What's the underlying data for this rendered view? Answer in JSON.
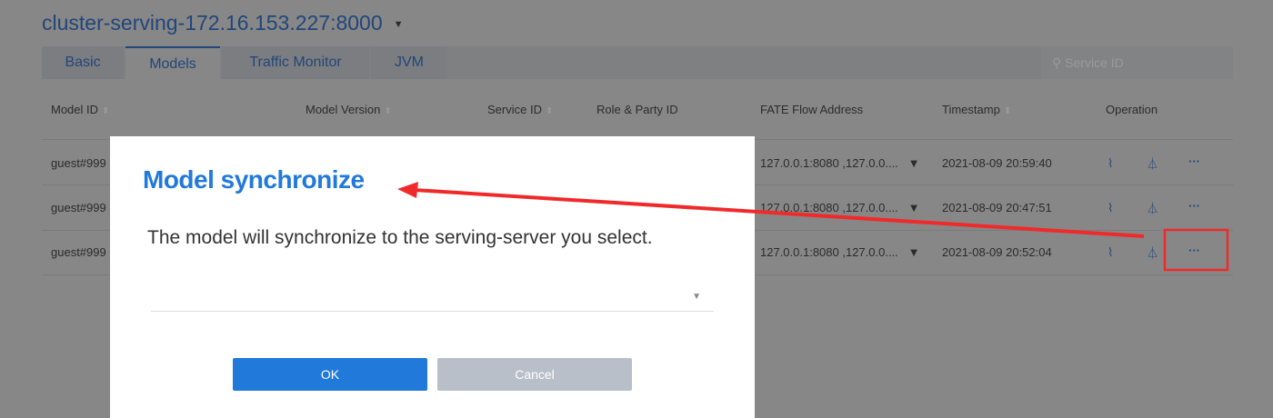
{
  "header": {
    "title": "cluster-serving-172.16.153.227:8000"
  },
  "tabs": [
    {
      "label": "Basic"
    },
    {
      "label": "Models"
    },
    {
      "label": "Traffic Monitor"
    },
    {
      "label": "JVM"
    }
  ],
  "search": {
    "placeholder": "Service ID"
  },
  "table": {
    "columns": [
      "Model ID",
      "Model Version",
      "Service ID",
      "Role & Party ID",
      "FATE Flow Address",
      "Timestamp",
      "Operation"
    ],
    "rows": [
      {
        "model_id": "guest#999",
        "address": "127.0.0.1:8080 ,127.0.0....",
        "timestamp": "2021-08-09 20:59:40"
      },
      {
        "model_id": "guest#999",
        "address": "127.0.0.1:8080 ,127.0.0....",
        "timestamp": "2021-08-09 20:47:51"
      },
      {
        "model_id": "guest#999",
        "address": "127.0.0.1:8080 ,127.0.0....",
        "timestamp": "2021-08-09 20:52:04"
      }
    ]
  },
  "modal": {
    "title": "Model synchronize",
    "text": "The model will synchronize to the serving-server you select.",
    "select_value": "",
    "ok": "OK",
    "cancel": "Cancel"
  },
  "colors": {
    "accent": "#217ad9",
    "annotation": "#f02a2a"
  }
}
